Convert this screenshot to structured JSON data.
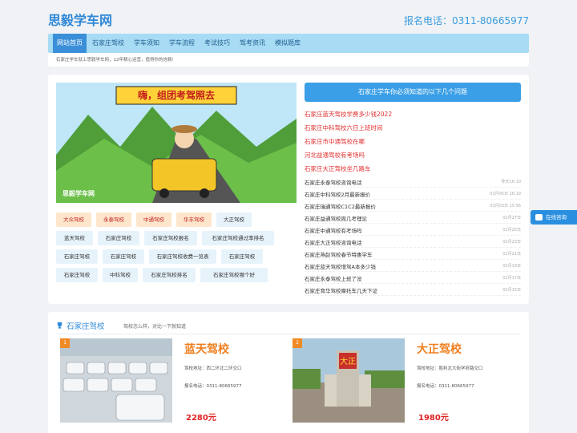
{
  "header": {
    "logo": "思毅学车网",
    "phone": "报名电话：0311-80665977"
  },
  "nav": [
    {
      "label": "网站首页",
      "active": true
    },
    {
      "label": "石家庄驾校"
    },
    {
      "label": "学车须知"
    },
    {
      "label": "学车流程"
    },
    {
      "label": "考试技巧"
    },
    {
      "label": "驾考资讯"
    },
    {
      "label": "模拟题库"
    }
  ],
  "notice": "石家庄学车就上思毅学车网，12年精心运营，值得你的信赖!",
  "banner": {
    "slogan": "嗨，组团考驾照去",
    "watermark": "思毅学车网"
  },
  "tags": [
    [
      "大众驾校",
      "永泰驾校",
      "中通驾校",
      "华丰驾校",
      "大正驾校"
    ],
    [
      "蓝天驾校",
      "石家庄驾校",
      "石家庄驾校报名",
      "石家庄驾校通过率排名"
    ],
    [
      "石家庄驾校",
      "石家庄驾校",
      "石家庄驾校收费一览表",
      "石家庄驾校"
    ],
    [
      "石家庄驾校",
      "中科驾校",
      "石家庄驾校排名",
      "石家庄驾校哪个好"
    ]
  ],
  "qa_title": "石家庄学车你必须知道的以下几个问题",
  "hot_links": [
    "石家庄蓝天驾校学费多少钱2022",
    "石家庄中科驾校六日上班时间",
    "石家庄市中通驾校在哪",
    "河北益通驾校有考场吗",
    "石家庄大正驾校坐几路车"
  ],
  "news": [
    {
      "title": "石家庄永泰驾校咨询电话",
      "date": "昨天16:10"
    },
    {
      "title": "石家庄中科驾校2月最新报价",
      "date": "03月05日 16:19"
    },
    {
      "title": "石家庄瑞通驾校C1C2最新报价",
      "date": "03月03日 15:56"
    },
    {
      "title": "石家庄益通驾校周几考理论",
      "date": "02月27日"
    },
    {
      "title": "石家庄中通驾校有考场吗",
      "date": "02月25日"
    },
    {
      "title": "石家庄大正驾校咨询电话",
      "date": "02月23日"
    },
    {
      "title": "石家庄燕赵驾校春节特惠学车",
      "date": "02月21日"
    },
    {
      "title": "石家庄蓝天驾校增驾A本多少钱",
      "date": "02月19日"
    },
    {
      "title": "石家庄永泰驾校上班了没",
      "date": "02月17日"
    },
    {
      "title": "石家庄育华驾校摩托车几天下证",
      "date": "02月15日"
    }
  ],
  "float_button": "在线咨询",
  "schools_section": {
    "title": "石家庄驾校",
    "subtitle": "驾校怎么样，对比一下就知道"
  },
  "schools": [
    {
      "num": "1",
      "name": "蓝天驾校",
      "addr": "驾校地址：西二环北二环交口",
      "tel": "报名电话：0311-80665977",
      "price": "2280元"
    },
    {
      "num": "2",
      "name": "大正驾校",
      "addr": "驾校地址：胜利北大街学府路交口",
      "tel": "报名电话：0311-80665977",
      "price": "1980元"
    }
  ],
  "colors": {
    "brand": "#2f88d8",
    "accent": "#f07f1f",
    "hot": "#e12e2e"
  }
}
